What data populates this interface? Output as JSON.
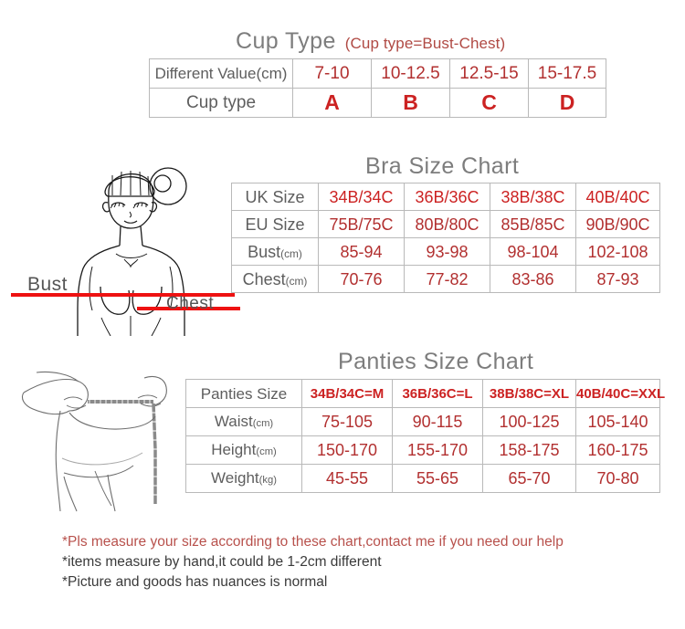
{
  "cup_type": {
    "title": "Cup Type",
    "subtitle": "(Cup type=Bust-Chest)",
    "rows": [
      {
        "label": "Different Value(cm)",
        "values": [
          "7-10",
          "10-12.5",
          "12.5-15",
          "15-17.5"
        ]
      },
      {
        "label": "Cup type",
        "values": [
          "A",
          "B",
          "C",
          "D"
        ]
      }
    ]
  },
  "bra": {
    "title": "Bra Size Chart",
    "rows": [
      {
        "label": "UK Size",
        "unit": "",
        "values": [
          "34B/34C",
          "36B/36C",
          "38B/38C",
          "40B/40C"
        ]
      },
      {
        "label": "EU Size",
        "unit": "",
        "values": [
          "75B/75C",
          "80B/80C",
          "85B/85C",
          "90B/90C"
        ]
      },
      {
        "label": "Bust",
        "unit": "(cm)",
        "values": [
          "85-94",
          "93-98",
          "98-104",
          "102-108"
        ]
      },
      {
        "label": "Chest",
        "unit": "(cm)",
        "values": [
          "70-76",
          "77-82",
          "83-86",
          "87-93"
        ]
      }
    ]
  },
  "panties": {
    "title": "Panties Size Chart",
    "header": {
      "label": "Panties Size",
      "values": [
        "34B/34C=M",
        "36B/36C=L",
        "38B/38C=XL",
        "40B/40C=XXL"
      ]
    },
    "rows": [
      {
        "label": "Waist",
        "unit": "(cm)",
        "values": [
          "75-105",
          "90-115",
          "100-125",
          "105-140"
        ]
      },
      {
        "label": "Height",
        "unit": "(cm)",
        "values": [
          "150-170",
          "155-170",
          "158-175",
          "160-175"
        ]
      },
      {
        "label": "Weight",
        "unit": "(kg)",
        "values": [
          "45-55",
          "55-65",
          "65-70",
          "70-80"
        ]
      }
    ]
  },
  "illustration": {
    "bust_label": "Bust",
    "chest_label": "Chest"
  },
  "notes": [
    "*Pls measure your size according to these chart,contact me if you need our help",
    "*items measure by hand,it could be 1-2cm different",
    "*Picture and goods has nuances is normal"
  ],
  "colors": {
    "value_red": "#cc2222",
    "label_gray": "#5e5e5e",
    "title_gray": "#7d7d7d",
    "note_red": "#b8514c",
    "measure_line": "#ee1111"
  }
}
